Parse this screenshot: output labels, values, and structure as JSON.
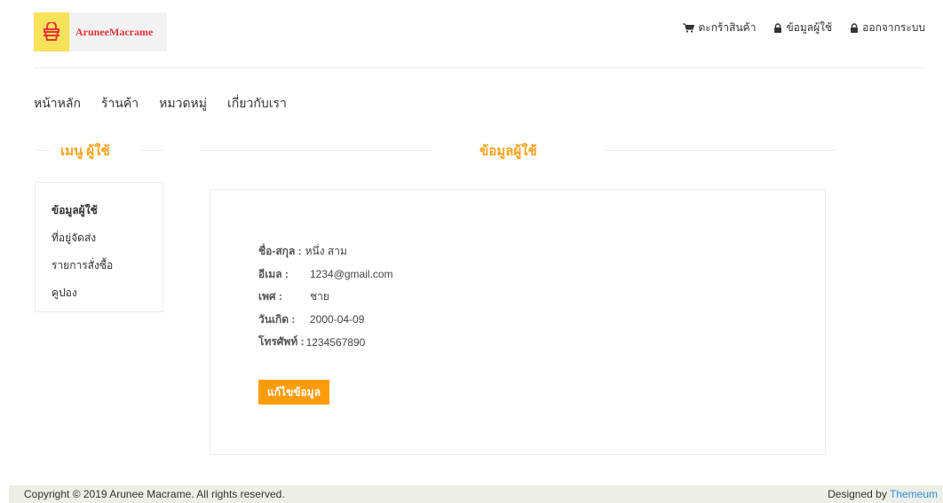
{
  "brand": {
    "name": "AruneeMacrame",
    "logo_icon": "basket-icon",
    "colors": {
      "logo_bg": "#f7e25a",
      "logo_text": "#e8333c"
    }
  },
  "top_nav": {
    "cart": {
      "label": "ตะกร้าสินค้า",
      "icon": "cart-icon"
    },
    "profile": {
      "label": "ข้อมูลผู้ใช้",
      "icon": "lock-icon"
    },
    "logout": {
      "label": "ออกจากระบบ",
      "icon": "lock-icon"
    }
  },
  "main_nav": {
    "home": "หน้าหลัก",
    "shop": "ร้านค้า",
    "categories": "หมวดหมู่",
    "about": "เกี่ยวกับเรา"
  },
  "sidebar": {
    "title": "เมนู ผู้ใช้",
    "items": [
      {
        "label": "ข้อมูลผู้ใช้",
        "active": true
      },
      {
        "label": "ที่อยู่จัดส่ง",
        "active": false
      },
      {
        "label": "รายการสั่งซื้อ",
        "active": false
      },
      {
        "label": "คูปอง",
        "active": false
      }
    ]
  },
  "profile": {
    "title": "ข้อมูลผู้ใช้",
    "fields": [
      {
        "label": "ชื่อ-สกุล :",
        "value": "หนึ่ง สาม"
      },
      {
        "label": "อีเมล :",
        "value": "1234@gmail.com"
      },
      {
        "label": "เพศ :",
        "value": "ชาย"
      },
      {
        "label": "วันเกิด :",
        "value": "2000-04-09"
      },
      {
        "label": "โทรศัพท์ :",
        "value": "1234567890"
      }
    ],
    "edit_button": "แก้ไขข้อมูล"
  },
  "footer": {
    "copyright": "Copyright © 2019 Arunee Macrame. All rights reserved.",
    "designed_by": "Designed by",
    "designer": "Themeum",
    "colors": {
      "accent": "#ff9c0c",
      "link": "#2f8fd8",
      "heading": "#f7a21a"
    }
  }
}
